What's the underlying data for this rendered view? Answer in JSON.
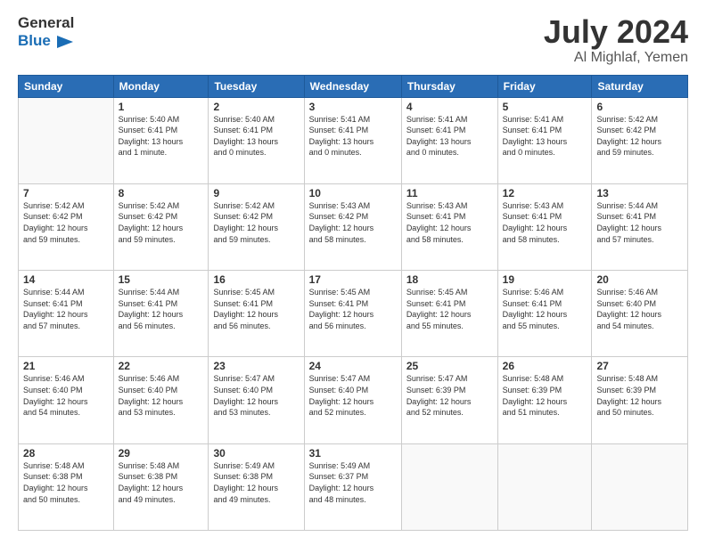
{
  "header": {
    "logo_line1": "General",
    "logo_line2": "Blue",
    "month": "July 2024",
    "location": "Al Mighlaf, Yemen"
  },
  "weekdays": [
    "Sunday",
    "Monday",
    "Tuesday",
    "Wednesday",
    "Thursday",
    "Friday",
    "Saturday"
  ],
  "weeks": [
    [
      {
        "day": "",
        "info": ""
      },
      {
        "day": "1",
        "info": "Sunrise: 5:40 AM\nSunset: 6:41 PM\nDaylight: 13 hours\nand 1 minute."
      },
      {
        "day": "2",
        "info": "Sunrise: 5:40 AM\nSunset: 6:41 PM\nDaylight: 13 hours\nand 0 minutes."
      },
      {
        "day": "3",
        "info": "Sunrise: 5:41 AM\nSunset: 6:41 PM\nDaylight: 13 hours\nand 0 minutes."
      },
      {
        "day": "4",
        "info": "Sunrise: 5:41 AM\nSunset: 6:41 PM\nDaylight: 13 hours\nand 0 minutes."
      },
      {
        "day": "5",
        "info": "Sunrise: 5:41 AM\nSunset: 6:41 PM\nDaylight: 13 hours\nand 0 minutes."
      },
      {
        "day": "6",
        "info": "Sunrise: 5:42 AM\nSunset: 6:42 PM\nDaylight: 12 hours\nand 59 minutes."
      }
    ],
    [
      {
        "day": "7",
        "info": "Sunrise: 5:42 AM\nSunset: 6:42 PM\nDaylight: 12 hours\nand 59 minutes."
      },
      {
        "day": "8",
        "info": "Sunrise: 5:42 AM\nSunset: 6:42 PM\nDaylight: 12 hours\nand 59 minutes."
      },
      {
        "day": "9",
        "info": "Sunrise: 5:42 AM\nSunset: 6:42 PM\nDaylight: 12 hours\nand 59 minutes."
      },
      {
        "day": "10",
        "info": "Sunrise: 5:43 AM\nSunset: 6:42 PM\nDaylight: 12 hours\nand 58 minutes."
      },
      {
        "day": "11",
        "info": "Sunrise: 5:43 AM\nSunset: 6:41 PM\nDaylight: 12 hours\nand 58 minutes."
      },
      {
        "day": "12",
        "info": "Sunrise: 5:43 AM\nSunset: 6:41 PM\nDaylight: 12 hours\nand 58 minutes."
      },
      {
        "day": "13",
        "info": "Sunrise: 5:44 AM\nSunset: 6:41 PM\nDaylight: 12 hours\nand 57 minutes."
      }
    ],
    [
      {
        "day": "14",
        "info": "Sunrise: 5:44 AM\nSunset: 6:41 PM\nDaylight: 12 hours\nand 57 minutes."
      },
      {
        "day": "15",
        "info": "Sunrise: 5:44 AM\nSunset: 6:41 PM\nDaylight: 12 hours\nand 56 minutes."
      },
      {
        "day": "16",
        "info": "Sunrise: 5:45 AM\nSunset: 6:41 PM\nDaylight: 12 hours\nand 56 minutes."
      },
      {
        "day": "17",
        "info": "Sunrise: 5:45 AM\nSunset: 6:41 PM\nDaylight: 12 hours\nand 56 minutes."
      },
      {
        "day": "18",
        "info": "Sunrise: 5:45 AM\nSunset: 6:41 PM\nDaylight: 12 hours\nand 55 minutes."
      },
      {
        "day": "19",
        "info": "Sunrise: 5:46 AM\nSunset: 6:41 PM\nDaylight: 12 hours\nand 55 minutes."
      },
      {
        "day": "20",
        "info": "Sunrise: 5:46 AM\nSunset: 6:40 PM\nDaylight: 12 hours\nand 54 minutes."
      }
    ],
    [
      {
        "day": "21",
        "info": "Sunrise: 5:46 AM\nSunset: 6:40 PM\nDaylight: 12 hours\nand 54 minutes."
      },
      {
        "day": "22",
        "info": "Sunrise: 5:46 AM\nSunset: 6:40 PM\nDaylight: 12 hours\nand 53 minutes."
      },
      {
        "day": "23",
        "info": "Sunrise: 5:47 AM\nSunset: 6:40 PM\nDaylight: 12 hours\nand 53 minutes."
      },
      {
        "day": "24",
        "info": "Sunrise: 5:47 AM\nSunset: 6:40 PM\nDaylight: 12 hours\nand 52 minutes."
      },
      {
        "day": "25",
        "info": "Sunrise: 5:47 AM\nSunset: 6:39 PM\nDaylight: 12 hours\nand 52 minutes."
      },
      {
        "day": "26",
        "info": "Sunrise: 5:48 AM\nSunset: 6:39 PM\nDaylight: 12 hours\nand 51 minutes."
      },
      {
        "day": "27",
        "info": "Sunrise: 5:48 AM\nSunset: 6:39 PM\nDaylight: 12 hours\nand 50 minutes."
      }
    ],
    [
      {
        "day": "28",
        "info": "Sunrise: 5:48 AM\nSunset: 6:38 PM\nDaylight: 12 hours\nand 50 minutes."
      },
      {
        "day": "29",
        "info": "Sunrise: 5:48 AM\nSunset: 6:38 PM\nDaylight: 12 hours\nand 49 minutes."
      },
      {
        "day": "30",
        "info": "Sunrise: 5:49 AM\nSunset: 6:38 PM\nDaylight: 12 hours\nand 49 minutes."
      },
      {
        "day": "31",
        "info": "Sunrise: 5:49 AM\nSunset: 6:37 PM\nDaylight: 12 hours\nand 48 minutes."
      },
      {
        "day": "",
        "info": ""
      },
      {
        "day": "",
        "info": ""
      },
      {
        "day": "",
        "info": ""
      }
    ]
  ]
}
